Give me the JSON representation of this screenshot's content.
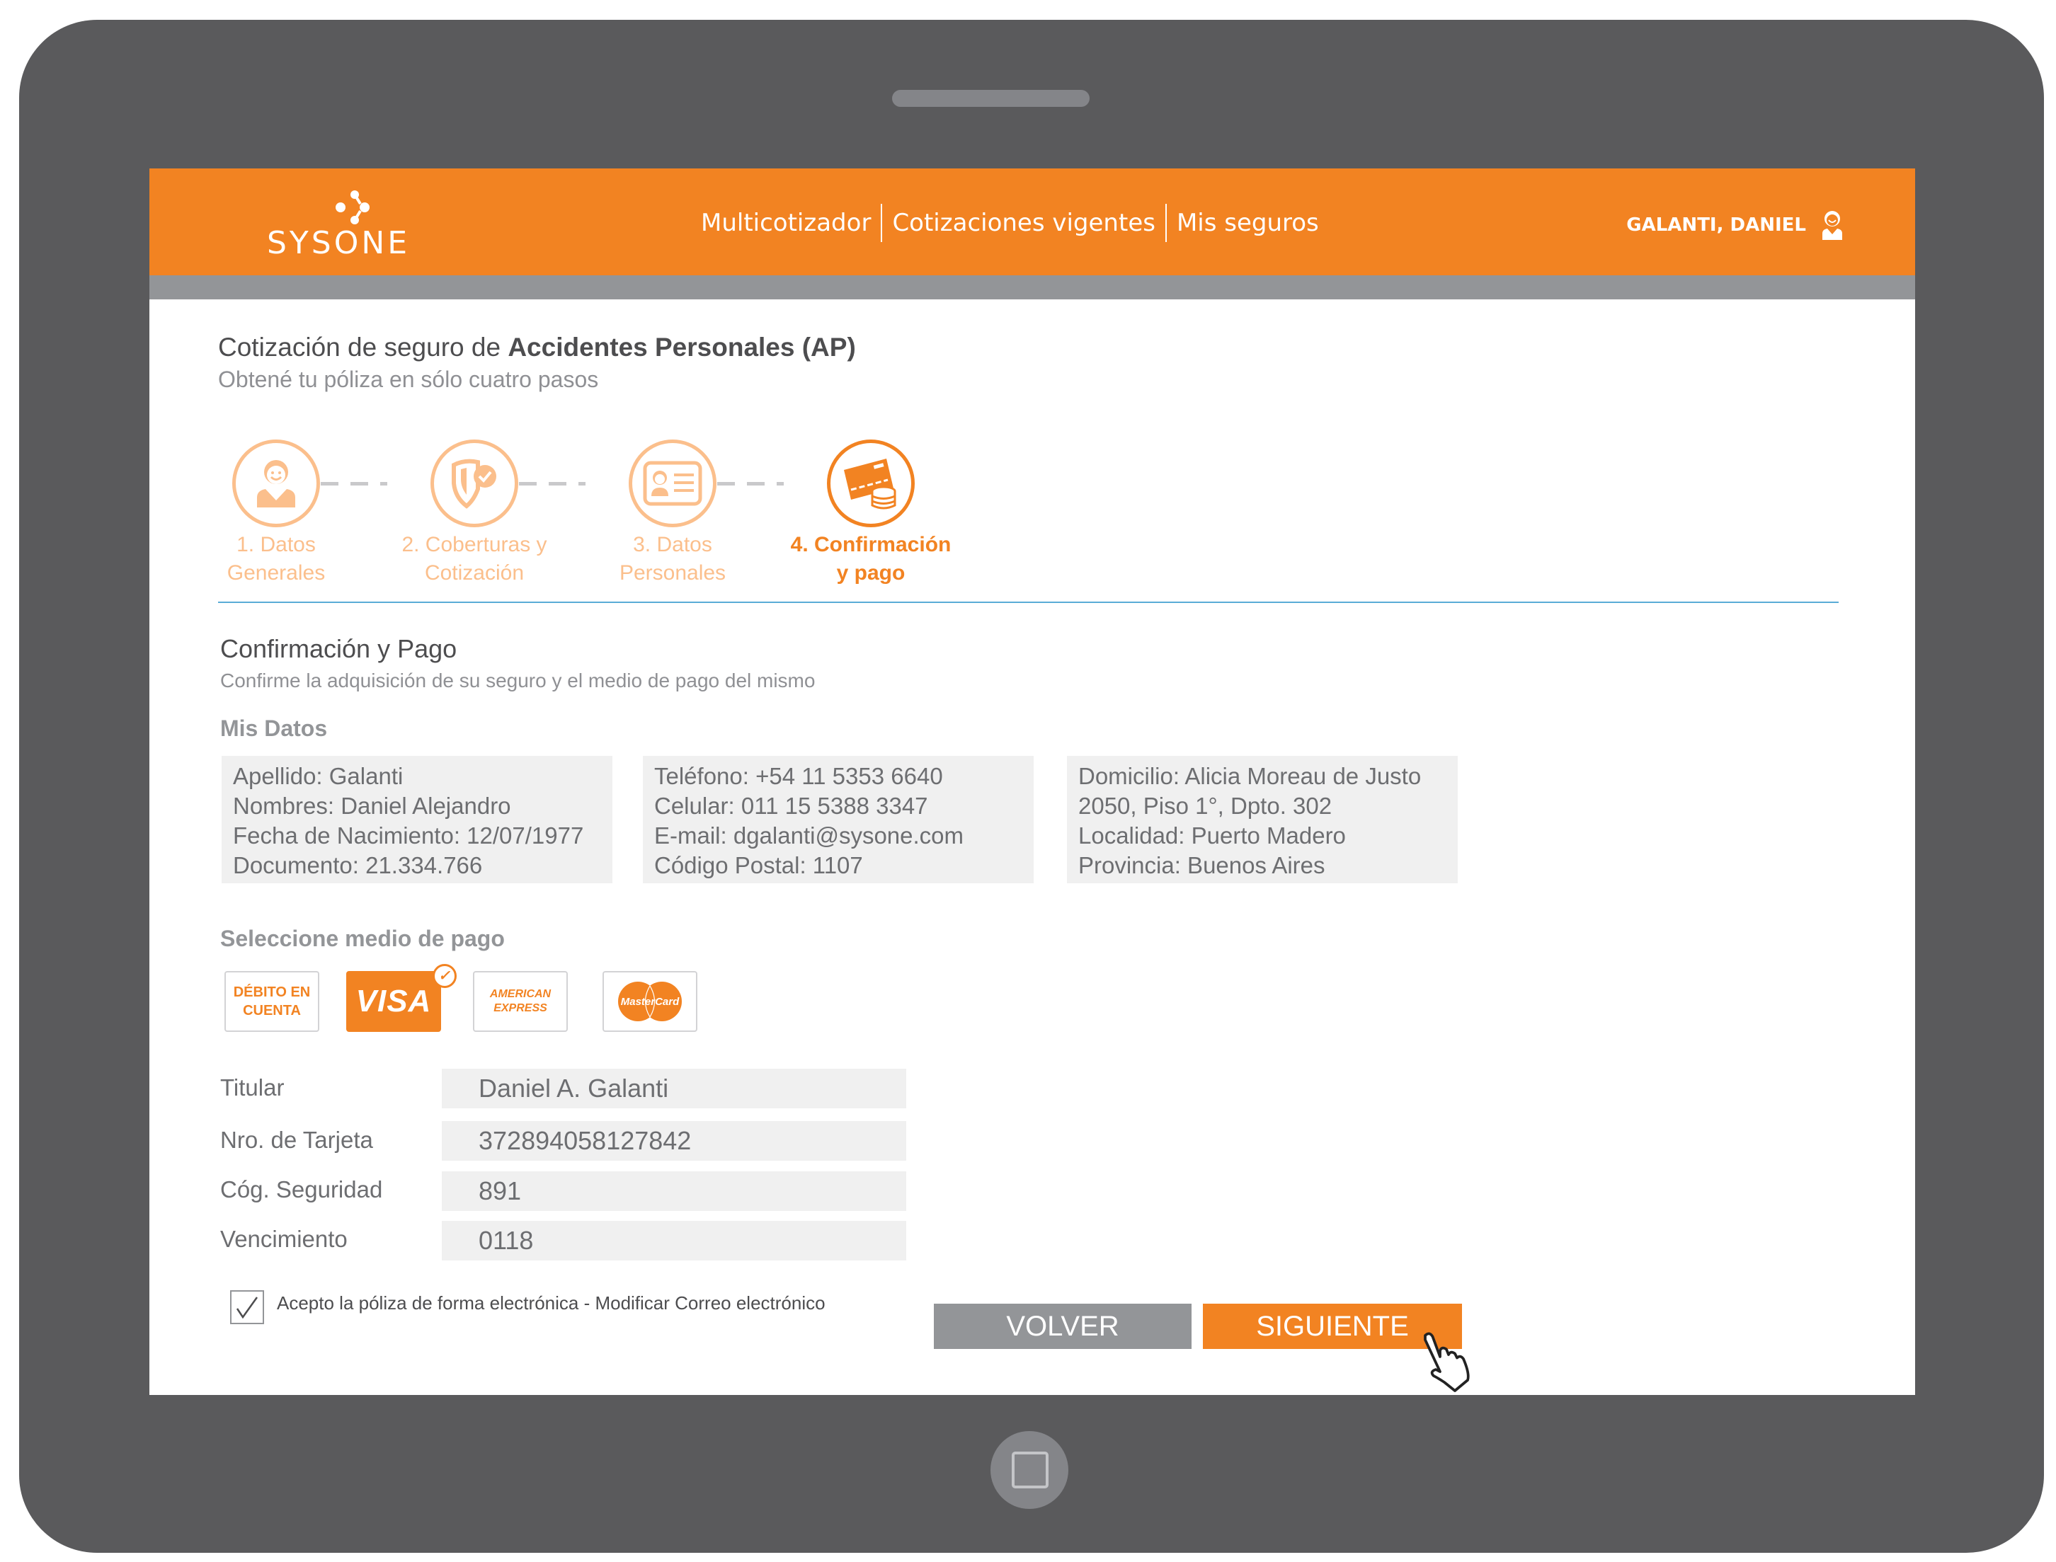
{
  "header": {
    "logo_text": "SYSONE",
    "nav": [
      {
        "label": "Multicotizador"
      },
      {
        "label": "Cotizaciones vigentes"
      },
      {
        "label": "Mis seguros"
      }
    ],
    "user_name": "GALANTI, DANIEL",
    "user_icon": "user-avatar-icon"
  },
  "page": {
    "title_prefix": "Cotización de seguro de ",
    "title_bold": "Accidentes Personales (AP)",
    "subtitle": "Obtené tu póliza en sólo cuatro pasos"
  },
  "stepper": {
    "current_step": 4,
    "steps": [
      {
        "line1": "1. Datos",
        "line2": "Generales",
        "icon": "person-icon"
      },
      {
        "line1": "2. Coberturas y",
        "line2": "Cotización",
        "icon": "shield-check-icon"
      },
      {
        "line1": "3. Datos",
        "line2": "Personales",
        "icon": "id-card-icon"
      },
      {
        "line1": "4. Confirmación",
        "line2": "y pago",
        "icon": "card-coins-icon"
      }
    ]
  },
  "section": {
    "title": "Confirmación y Pago",
    "subtitle": "Confirme la adquisición de su seguro y el medio de pago del mismo",
    "mis_datos_label": "Mis Datos",
    "boxes": [
      [
        "Apellido: Galanti",
        "Nombres: Daniel Alejandro",
        "Fecha de Nacimiento: 12/07/1977",
        "Documento: 21.334.766"
      ],
      [
        "Teléfono: +54 11 5353 6640",
        "Celular: 011 15 5388 3347",
        "E-mail: dgalanti@sysone.com",
        "Código Postal: 1107"
      ],
      [
        "Domicilio: Alicia Moreau de Justo",
        "2050, Piso 1°, Dpto. 302",
        "Localidad: Puerto Madero",
        "Provincia: Buenos Aires"
      ]
    ]
  },
  "payment": {
    "label": "Seleccione medio de pago",
    "selected": "VISA",
    "options": [
      {
        "line1": "DÉBITO EN",
        "line2": "CUENTA"
      },
      {
        "label": "VISA"
      },
      {
        "line1": "AMERICAN",
        "line2": "EXPRESS"
      },
      {
        "label": "MasterCard"
      }
    ]
  },
  "form": {
    "titular_label": "Titular",
    "titular_value": "Daniel A. Galanti",
    "card_label": "Nro. de Tarjeta",
    "card_value": "372894058127842",
    "cvv_label": "Cóg. Seguridad",
    "cvv_value": "891",
    "expiry_label": "Vencimiento",
    "expiry_value": "0118"
  },
  "accept": {
    "checked": true,
    "text": "Acepto la póliza de forma electrónica - Modificar Correo electrónico"
  },
  "buttons": {
    "back": "VOLVER",
    "next": "SIGUIENTE"
  },
  "colors": {
    "brand_orange": "#f28322",
    "light_orange": "#fbbf8c",
    "gray": "#939598",
    "frame": "#5a5a5c",
    "separator_blue": "#5aacd6"
  }
}
